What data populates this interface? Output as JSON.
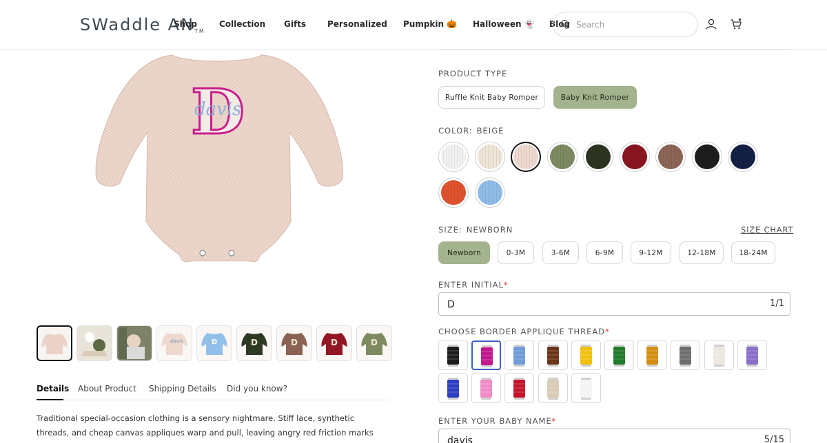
{
  "header": {
    "logo": "SWaddle AN",
    "logo_suffix": "TM",
    "nav": [
      "Shop",
      "Collection",
      "Gifts",
      "Personalized",
      "Pumpkin 🎃",
      "Halloween 👻",
      "Blog"
    ],
    "search_placeholder": "Search",
    "icons": [
      "search-icon",
      "account-icon",
      "cart-icon"
    ]
  },
  "gallery": {
    "main_image_initial": "D",
    "main_image_name": "davis",
    "thumb_count": 9,
    "thumb_initials": [
      "",
      "",
      "",
      "",
      "",
      "D",
      "D",
      "D",
      "D"
    ]
  },
  "tabs": {
    "items": [
      "Details",
      "About Product",
      "Shipping Details",
      "Did you know?"
    ],
    "active": "Details"
  },
  "description": "Traditional special-occasion clothing is a sensory nightmare. Stiff lace, synthetic threads, and cheap canvas appliques warp and pull, leaving angry red friction marks directly on your",
  "product_type": {
    "label": "PRODUCT TYPE",
    "options": [
      "Ruffle Knit Baby Romper",
      "Baby Knit Romper"
    ],
    "selected": "Baby Knit Romper"
  },
  "color": {
    "label": "COLOR:",
    "value": "BEIGE",
    "swatches": [
      "#f2f2f2",
      "#efe6d8",
      "#efd9d0",
      "#7d8a62",
      "#2c3521",
      "#8a1520",
      "#8d6556",
      "#1d1d1d",
      "#142044",
      "#e0522e",
      "#8fbde8"
    ],
    "selected_index": 2
  },
  "size": {
    "label": "SIZE:",
    "value": "NEWBORN",
    "chart_link": "SIZE CHART",
    "options": [
      "Newborn",
      "0-3M",
      "3-6M",
      "6-9M",
      "9-12M",
      "12-18M",
      "18-24M"
    ],
    "selected": "Newborn"
  },
  "initial": {
    "label": "ENTER INITIAL",
    "value": "D",
    "count": "1/1"
  },
  "thread": {
    "label": "CHOOSE BORDER APPLIQUE THREAD",
    "colors": [
      "#1c1c1c",
      "#c2188e",
      "#6f9bd8",
      "#6b3418",
      "#f0c010",
      "#237a2a",
      "#d48f12",
      "#6d6d6d",
      "#ece8e0",
      "#8a6fc9",
      "#2d3ec2",
      "#ef8cc6",
      "#c4152b",
      "#d9ccb6",
      "#f4f4f4"
    ],
    "selected_index": 1
  },
  "baby_name": {
    "label": "ENTER YOUR BABY NAME",
    "value": "davis",
    "count": "5/15"
  }
}
